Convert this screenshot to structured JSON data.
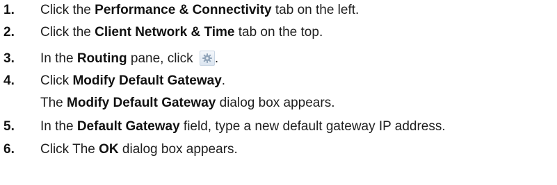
{
  "steps": [
    {
      "num": "1.",
      "pre": "Click the ",
      "bold": "Performance & Connectivity",
      "post": " tab on the left."
    },
    {
      "num": "2.",
      "pre": "Click the ",
      "bold": "Client Network & Time",
      "post": " tab on the top."
    },
    {
      "num": "3.",
      "pre": "In the ",
      "bold": "Routing",
      "post": " pane, click ",
      "after_icon": "."
    },
    {
      "num": "4.",
      "pre": "Click ",
      "bold": "Modify Default Gateway",
      "post": "."
    },
    {
      "cont_pre": "The ",
      "cont_bold": "Modify Default Gateway",
      "cont_post": " dialog box appears."
    },
    {
      "num": "5.",
      "pre": "In the ",
      "bold": "Default Gateway",
      "post": " field, type a new default gateway IP address."
    },
    {
      "num": "6.",
      "pre": "Click The ",
      "bold": "OK",
      "post": " dialog box appears."
    }
  ],
  "icons": {
    "step3_button": "gear-icon"
  },
  "colors": {
    "text": "#1f1f1f",
    "gear_button_bg": "#dbe5f0"
  }
}
